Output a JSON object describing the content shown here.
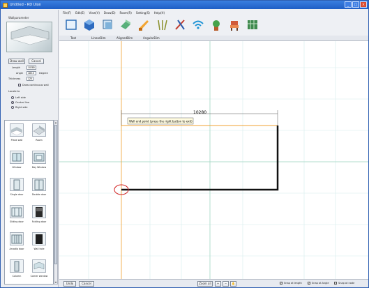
{
  "window": {
    "title": "Untitled - RD Uion"
  },
  "left_panel": {
    "section_title": "Wallparameter",
    "draw_wall_label": "Draw wall",
    "cancel_label": "Cancel",
    "params": {
      "length_label": "Length",
      "length_value": "10280",
      "angle_label": "Angle",
      "angle_value": "180.0",
      "angle_unit": "Degree",
      "thickness_label": "Thickness",
      "thickness_value": "120",
      "continuous_label": "Draw continuous wall",
      "continuous_checked": true
    },
    "locate_label": "Locate to",
    "locate_options": [
      "Left side",
      "Central line",
      "Right side"
    ],
    "locate_selected": "Central line",
    "palette": [
      "Plane wall",
      "Room",
      "Window",
      "Bay Window",
      "Single door",
      "Double door",
      "Sliding door",
      "Folding door",
      "Arcadia door",
      "Wall hole",
      "Column",
      "Corner window"
    ]
  },
  "menu": [
    "File(F)",
    "Edit(E)",
    "View(V)",
    "Draw(D)",
    "Room(R)",
    "Setting(S)",
    "Help(H)"
  ],
  "toolbar_icons": [
    "select-icon",
    "cube-icon",
    "layers-icon",
    "wall-icon",
    "brush-icon",
    "rails-icon",
    "tools-icon",
    "wifi-icon",
    "plant-icon",
    "chair-icon",
    "grid-icon"
  ],
  "tabs": [
    "Text",
    "LinearDim",
    "AlignedDim",
    "AngularDim"
  ],
  "canvas": {
    "dimension_value": "10280",
    "tooltip": "Wall end point (press the right button to exit)"
  },
  "status": {
    "undo_label": "Undo",
    "cancel_label": "Cancel",
    "zoom_all_label": "Zoom all",
    "snap_length_label": "Snap at length",
    "snap_angle_label": "Snap at Angle",
    "snap_node_label": "Snap at node"
  },
  "colors": {
    "titlebar": "#1f5ec5",
    "grid": "#d6ecec",
    "wall": "#111111",
    "guide_orange": "#f0a030",
    "highlight_red": "#d32020"
  }
}
